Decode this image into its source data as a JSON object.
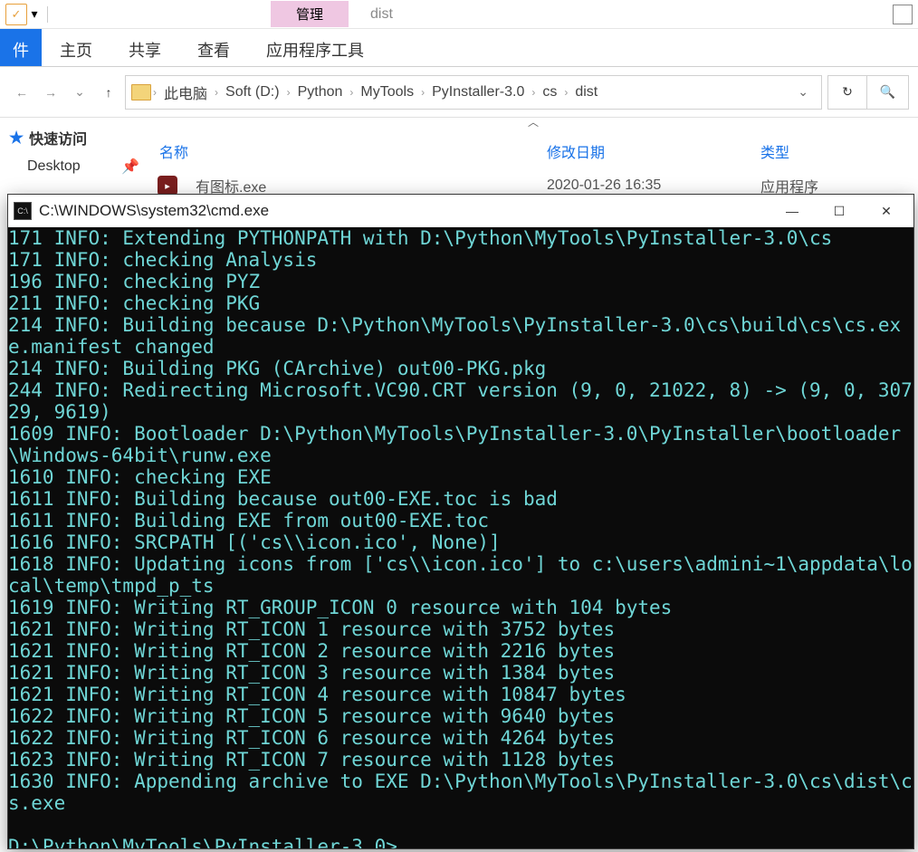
{
  "explorer": {
    "manage_label": "管理",
    "window_title": "dist",
    "tabs": {
      "file": "件",
      "home": "主页",
      "share": "共享",
      "view": "查看",
      "apptools": "应用程序工具"
    },
    "breadcrumbs": [
      "此电脑",
      "Soft (D:)",
      "Python",
      "MyTools",
      "PyInstaller-3.0",
      "cs",
      "dist"
    ],
    "sidebar": {
      "quick_access": "快速访问",
      "desktop": "Desktop"
    },
    "columns": {
      "name": "名称",
      "date": "修改日期",
      "type": "类型"
    },
    "files": [
      {
        "name": "有图标.exe",
        "date": "2020-01-26 16:35",
        "type": "应用程序"
      }
    ]
  },
  "cmd": {
    "title": "C:\\WINDOWS\\system32\\cmd.exe",
    "lines": [
      "171 INFO: Extending PYTHONPATH with D:\\Python\\MyTools\\PyInstaller-3.0\\cs",
      "171 INFO: checking Analysis",
      "196 INFO: checking PYZ",
      "211 INFO: checking PKG",
      "214 INFO: Building because D:\\Python\\MyTools\\PyInstaller-3.0\\cs\\build\\cs\\cs.exe.manifest changed",
      "214 INFO: Building PKG (CArchive) out00-PKG.pkg",
      "244 INFO: Redirecting Microsoft.VC90.CRT version (9, 0, 21022, 8) -> (9, 0, 30729, 9619)",
      "1609 INFO: Bootloader D:\\Python\\MyTools\\PyInstaller-3.0\\PyInstaller\\bootloader\\Windows-64bit\\runw.exe",
      "1610 INFO: checking EXE",
      "1611 INFO: Building because out00-EXE.toc is bad",
      "1611 INFO: Building EXE from out00-EXE.toc",
      "1616 INFO: SRCPATH [('cs\\\\icon.ico', None)]",
      "1618 INFO: Updating icons from ['cs\\\\icon.ico'] to c:\\users\\admini~1\\appdata\\local\\temp\\tmpd_p_ts",
      "1619 INFO: Writing RT_GROUP_ICON 0 resource with 104 bytes",
      "1621 INFO: Writing RT_ICON 1 resource with 3752 bytes",
      "1621 INFO: Writing RT_ICON 2 resource with 2216 bytes",
      "1621 INFO: Writing RT_ICON 3 resource with 1384 bytes",
      "1621 INFO: Writing RT_ICON 4 resource with 10847 bytes",
      "1622 INFO: Writing RT_ICON 5 resource with 9640 bytes",
      "1622 INFO: Writing RT_ICON 6 resource with 4264 bytes",
      "1623 INFO: Writing RT_ICON 7 resource with 1128 bytes",
      "1630 INFO: Appending archive to EXE D:\\Python\\MyTools\\PyInstaller-3.0\\cs\\dist\\cs.exe"
    ],
    "prompt": "D:\\Python\\MyTools\\PyInstaller-3.0>"
  }
}
